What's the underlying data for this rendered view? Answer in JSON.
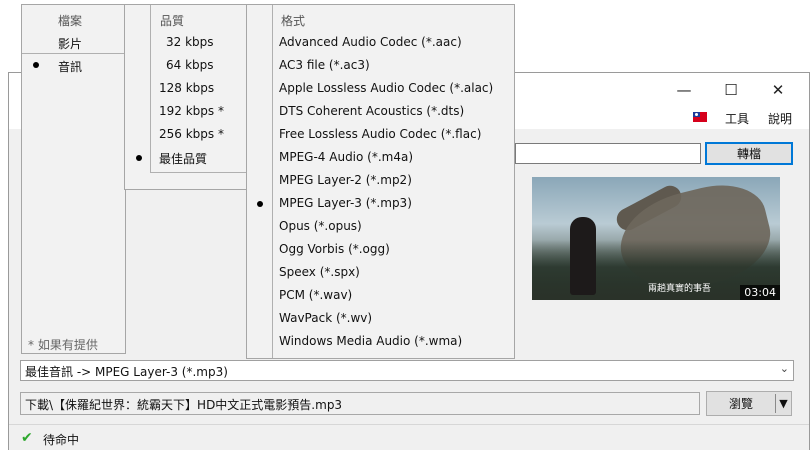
{
  "window": {
    "controls": {
      "minimize": "—",
      "maximize": "☐",
      "close": "✕"
    },
    "menubar": {
      "flag_icon": "taiwan-flag-icon",
      "tools": "工具",
      "help": "說明"
    },
    "url_value": "",
    "convert_label": "轉檔"
  },
  "thumbnail": {
    "subtitle": "兩趟真實的事吾",
    "duration": "03:04"
  },
  "format_select": {
    "value": "最佳音訊 -> MPEG Layer-3 (*.mp3)",
    "arrow_icon": "chevron-down-icon"
  },
  "output_path": {
    "value": "下載\\【侏羅紀世界：統霸天下】HD中文正式電影預告.mp3",
    "browse_label": "瀏覽",
    "dropdown_icon": "triangle-down-icon"
  },
  "status": {
    "icon": "checkmark-icon",
    "text": "待命中"
  },
  "menu_type": {
    "header": "檔案",
    "items": [
      {
        "label": "影片",
        "selected": false
      },
      {
        "label": "音訊",
        "selected": true
      }
    ],
    "note": "* 如果有提供"
  },
  "menu_quality": {
    "header": "品質",
    "items": [
      {
        "label": "32 kbps",
        "selected": false
      },
      {
        "label": "64 kbps",
        "selected": false
      },
      {
        "label": "128 kbps",
        "selected": false
      },
      {
        "label": "192 kbps *",
        "selected": false
      },
      {
        "label": "256 kbps *",
        "selected": false
      },
      {
        "label": "最佳品質",
        "selected": true
      }
    ]
  },
  "menu_format": {
    "header": "格式",
    "items": [
      {
        "label": "Advanced Audio Codec (*.aac)",
        "selected": false
      },
      {
        "label": "AC3 file (*.ac3)",
        "selected": false
      },
      {
        "label": "Apple Lossless Audio Codec (*.alac)",
        "selected": false
      },
      {
        "label": "DTS Coherent Acoustics (*.dts)",
        "selected": false
      },
      {
        "label": "Free Lossless Audio Codec (*.flac)",
        "selected": false
      },
      {
        "label": "MPEG-4 Audio (*.m4a)",
        "selected": false
      },
      {
        "label": "MPEG Layer-2 (*.mp2)",
        "selected": false
      },
      {
        "label": "MPEG Layer-3 (*.mp3)",
        "selected": true
      },
      {
        "label": "Opus (*.opus)",
        "selected": false
      },
      {
        "label": "Ogg Vorbis (*.ogg)",
        "selected": false
      },
      {
        "label": "Speex (*.spx)",
        "selected": false
      },
      {
        "label": "PCM (*.wav)",
        "selected": false
      },
      {
        "label": "WavPack (*.wv)",
        "selected": false
      },
      {
        "label": "Windows Media Audio (*.wma)",
        "selected": false
      }
    ]
  }
}
